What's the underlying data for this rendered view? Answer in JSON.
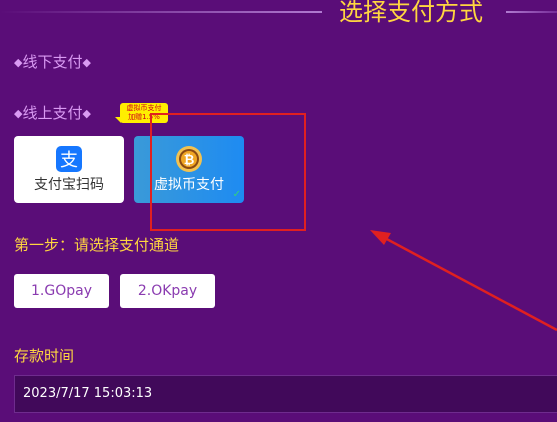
{
  "header": {
    "title": "选择支付方式"
  },
  "offline": {
    "label": "线下支付",
    "diamond": "◆"
  },
  "online": {
    "label": "线上支付",
    "diamond": "◆",
    "promo_badge_line1": "虚拟币支付",
    "promo_badge_line2": "加赠1.5%"
  },
  "payment_methods": [
    {
      "label": "支付宝扫码",
      "icon": "alipay-icon",
      "selected": false
    },
    {
      "label": "虚拟币支付",
      "icon": "bitcoin-icon",
      "selected": true,
      "check": "✓"
    }
  ],
  "step": {
    "title": "第一步：请选择支付通道",
    "channels": [
      "1.GOpay",
      "2.OKpay"
    ]
  },
  "deposit": {
    "label": "存款时间",
    "time_value": "2023/7/17 15:03:13"
  },
  "colors": {
    "background": "#5a0d78",
    "title_gold": "#ffd640",
    "section_purple": "#d99af2",
    "highlight_red": "#e02020",
    "selected_blue": "#1e8bf2"
  }
}
